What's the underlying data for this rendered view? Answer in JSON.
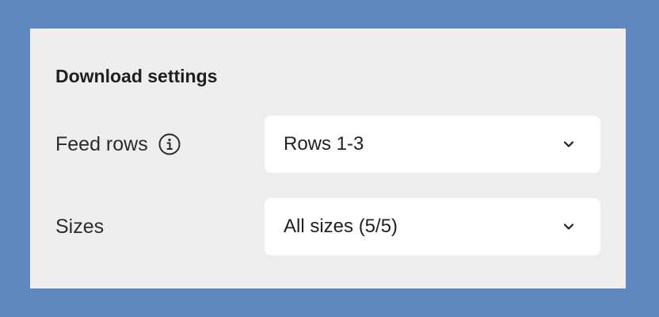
{
  "panel": {
    "title": "Download settings"
  },
  "settings": [
    {
      "label": "Feed rows",
      "has_info_icon": true,
      "info_icon": "info-circle-icon",
      "selected_value": "Rows 1-3",
      "dropdown_icon": "chevron-down-icon"
    },
    {
      "label": "Sizes",
      "has_info_icon": false,
      "selected_value": "All sizes (5/5)",
      "dropdown_icon": "chevron-down-icon"
    }
  ],
  "colors": {
    "background": "#5f88c0",
    "panel": "#efeeec",
    "select_bg": "#ffffff",
    "text": "#222222"
  }
}
